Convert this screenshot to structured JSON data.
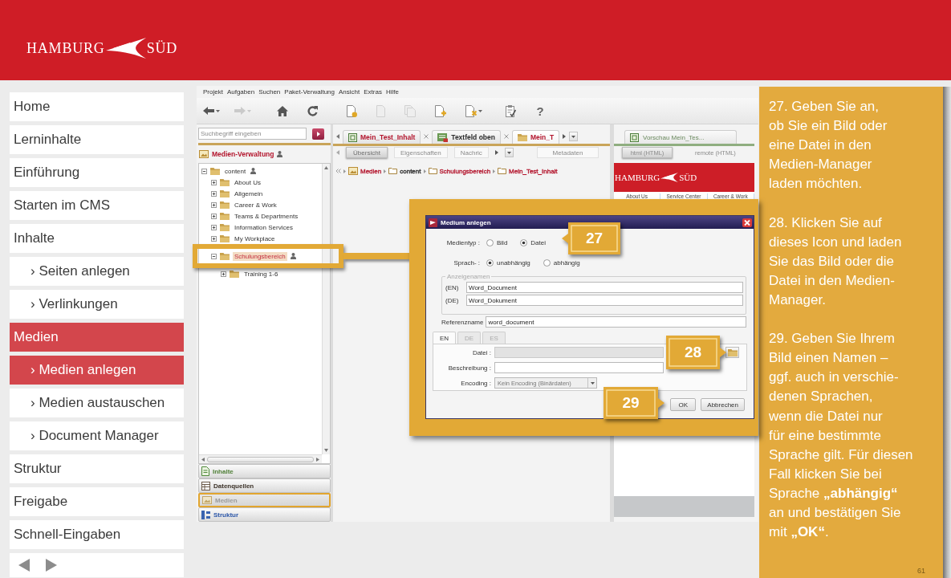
{
  "header": {
    "logo": {
      "left": "HAMBURG",
      "right": "SÜD"
    }
  },
  "sidebar": {
    "items": [
      {
        "label": "Home",
        "selected": false
      },
      {
        "label": "Lerninhalte",
        "selected": false
      },
      {
        "label": "Einführung",
        "selected": false
      },
      {
        "label": "Starten im CMS",
        "selected": false
      },
      {
        "label": "Inhalte",
        "selected": false,
        "children": [
          {
            "label": "› Seiten anlegen",
            "selected": false
          },
          {
            "label": "› Verlinkungen",
            "selected": false
          }
        ]
      },
      {
        "label": "Medien",
        "selected": true,
        "children": [
          {
            "label": "› Medien anlegen",
            "selected": true
          },
          {
            "label": "› Medien austauschen",
            "selected": false
          },
          {
            "label": "› Document Manager",
            "selected": false
          }
        ]
      },
      {
        "label": "Struktur",
        "selected": false
      },
      {
        "label": "Freigabe",
        "selected": false
      },
      {
        "label": "Schnell-Eingaben",
        "selected": false
      }
    ]
  },
  "cms": {
    "menu": [
      "Projekt",
      "Aufgaben",
      "Suchen",
      "Paket-Verwaltung",
      "Ansicht",
      "Extras",
      "Hilfe"
    ],
    "toolbar": [
      {
        "kind": "back",
        "disabled": false,
        "dropdown": true
      },
      {
        "kind": "forward",
        "disabled": true,
        "dropdown": true
      },
      {
        "kind": "home",
        "disabled": false,
        "dropdown": false
      },
      {
        "kind": "refresh",
        "disabled": false,
        "dropdown": false
      },
      {
        "kind": "new-document",
        "disabled": false,
        "dropdown": false
      },
      {
        "kind": "document",
        "disabled": true,
        "dropdown": false
      },
      {
        "kind": "copy-document",
        "disabled": true,
        "dropdown": false
      },
      {
        "kind": "add-document",
        "disabled": false,
        "dropdown": false
      },
      {
        "kind": "delete-document",
        "disabled": false,
        "dropdown": true
      },
      {
        "kind": "task",
        "disabled": false,
        "dropdown": false
      },
      {
        "kind": "help",
        "disabled": false,
        "dropdown": false,
        "label": "?"
      }
    ],
    "search": {
      "placeholder": "Suchbegriff eingeben"
    },
    "navigator": {
      "title": "Medien-Verwaltung",
      "tree": [
        {
          "label": "content",
          "expanded": true,
          "selected": false,
          "person_mark": true,
          "children": [
            {
              "label": "About Us",
              "expanded": false,
              "selected": false,
              "person_mark": false
            },
            {
              "label": "Allgemein",
              "expanded": false,
              "selected": false,
              "person_mark": false
            },
            {
              "label": "Career & Work",
              "expanded": false,
              "selected": false,
              "person_mark": false
            },
            {
              "label": "Teams & Departments",
              "expanded": false,
              "selected": false,
              "person_mark": false
            },
            {
              "label": "Information Services",
              "expanded": false,
              "selected": false,
              "person_mark": false
            },
            {
              "label": "My Workplace",
              "expanded": false,
              "selected": false,
              "person_mark": false
            },
            {
              "label": "Schulungsbereich",
              "expanded": true,
              "selected": true,
              "person_mark": true,
              "children": [
                {
                  "label": "Training 1-6",
                  "expanded": false,
                  "selected": false,
                  "person_mark": false
                }
              ]
            }
          ]
        }
      ]
    },
    "panels": [
      {
        "label": "Inhalte",
        "kind": "contents",
        "selected": false
      },
      {
        "label": "Datenquellen",
        "kind": "datasources",
        "selected": false
      },
      {
        "label": "Medien",
        "kind": "media",
        "selected": true
      },
      {
        "label": "Struktur",
        "kind": "structure",
        "selected": false
      }
    ],
    "editor_tabs": [
      {
        "label": "Mein_Test_Inhalt",
        "kind": "page",
        "selected": false,
        "color": "#b3142c"
      },
      {
        "label": "Textfeld oben",
        "kind": "section",
        "selected": false,
        "color": "#2a2a2a"
      },
      {
        "label": "Mein_T",
        "kind": "folder",
        "selected": true,
        "color": "#b3142c"
      }
    ],
    "view_tabs": [
      {
        "label": "Übersicht",
        "selected": true
      },
      {
        "label": "Eigenschaften",
        "selected": false
      },
      {
        "label": "Nachric",
        "selected": false
      }
    ],
    "metadata_tab": "Metadaten",
    "breadcrumb": [
      {
        "label": "Medien",
        "kind": "media",
        "color": "#b3142c"
      },
      {
        "label": "content",
        "kind": "folder",
        "color": "#2a2a2a"
      },
      {
        "label": "Schulungsbereich",
        "kind": "folder",
        "color": "#b3142c"
      },
      {
        "label": "Mein_Test_Inhalt",
        "kind": "folder",
        "color": "#b3142c"
      }
    ],
    "preview": {
      "tab": "Vorschau Mein_Tes...",
      "views": [
        {
          "label": "html (HTML)",
          "selected": true
        },
        {
          "label": "remote (HTML)",
          "selected": false
        }
      ],
      "site": {
        "logo": {
          "left": "HAMBURG",
          "right": "SÜD"
        },
        "nav": [
          "About Us",
          "Service Center",
          "Career & Work"
        ]
      }
    },
    "dialog": {
      "title": "Medium anlegen",
      "media_type": {
        "label": "Medientyp :",
        "options": [
          {
            "label": "Bild",
            "selected": false
          },
          {
            "label": "Datei",
            "selected": true
          }
        ]
      },
      "language": {
        "label": "Sprach- :",
        "options": [
          {
            "label": "unabhängig",
            "selected": true
          },
          {
            "label": "abhängig",
            "selected": false
          }
        ]
      },
      "display_names": {
        "legend": "Anzeigenamen",
        "fields": [
          {
            "label": "(EN)",
            "value": "Word_Document"
          },
          {
            "label": "(DE)",
            "value": "Word_Dokument"
          }
        ]
      },
      "reference": {
        "label": "Referenzname",
        "value": "word_document"
      },
      "tabs": [
        {
          "label": "EN",
          "selected": true
        },
        {
          "label": "DE",
          "selected": false
        },
        {
          "label": "ES",
          "selected": false
        }
      ],
      "file": {
        "label": "Datei :",
        "disabled": true
      },
      "description": {
        "label": "Beschreibung :"
      },
      "encoding": {
        "label": "Encoding :",
        "value": "Kein Encoding (Binärdaten)"
      },
      "buttons": [
        "OK",
        "Abbrechen"
      ]
    },
    "callouts": [
      "27",
      "28",
      "29"
    ]
  },
  "instructions": {
    "paragraphs": [
      "27. Geben Sie an,\nob Sie ein Bild oder\neine Datei in den\nMedien-Manager\nladen möchten.",
      "28. Klicken Sie auf\ndieses Icon und laden\nSie das Bild oder die\nDatei in den Medien-\nManager.",
      "29. Geben Sie Ihrem\nBild einen Namen –\nggf. auch in verschie-\ndenen Sprachen,\nwenn die Datei nur\nfür eine bestimmte\nSprache gilt. Für diesen\nFall klicken Sie bei\nSprache **„abhängig“**\nan und bestätigen Sie\nmit **„OK“**."
    ],
    "page_number": "61"
  }
}
